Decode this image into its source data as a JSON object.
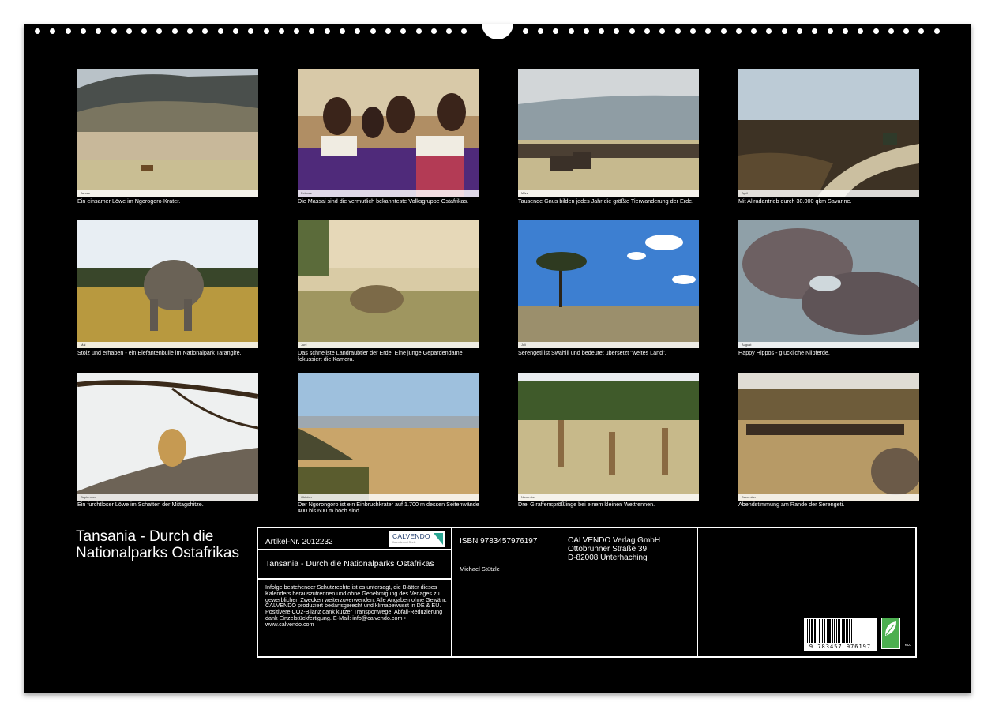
{
  "photos": [
    {
      "caption": "Ein einsamer Löwe im Ngorogoro-Krater.",
      "month": "Januar"
    },
    {
      "caption": "Die Massai sind die vermutlich bekannteste Volksgruppe Ostafrikas.",
      "month": "Februar"
    },
    {
      "caption": "Tausende Gnus bilden jedes Jahr die größte Tierwanderung der Erde.",
      "month": "März"
    },
    {
      "caption": "Mit Allradantrieb durch 30.000 qkm Savanne.",
      "month": "April"
    },
    {
      "caption": "Stolz und erhaben - ein Elefantenbulle im Nationalpark Tarangire.",
      "month": "Mai"
    },
    {
      "caption": "Das schnellste Landraubtier der Erde. Eine junge Gepardendame fokussiert die Kamera.",
      "month": "Juni"
    },
    {
      "caption": "Serengeti ist Swahili und bedeutet übersetzt \"weites Land\".",
      "month": "Juli"
    },
    {
      "caption": "Happy Hippos - glückliche Nilpferde.",
      "month": "August"
    },
    {
      "caption": "Ein furchtloser Löwe im Schatten der Mittagshitze.",
      "month": "September"
    },
    {
      "caption": "Der Ngorongoro ist ein Einbruchkrater auf 1.700 m dessen Seitenwände 400 bis 600 m hoch sind.",
      "month": "Oktober"
    },
    {
      "caption": "Drei Giraffensprößlinge bei einem kleinen Wettrennen.",
      "month": "November"
    },
    {
      "caption": "Abendstimmung am Rande der Serengeti.",
      "month": "Dezember"
    }
  ],
  "calendar_title": "Tansania - Durch die Nationalparks Ostafrikas",
  "info": {
    "article_no": "Artikel-Nr. 2012232",
    "calvendo_logo": "CALVENDO",
    "calvendo_logo_sub": "Kalender mit Seele",
    "title": "Tansania - Durch die Nationalparks Ostafrikas",
    "legal": "Infolge bestehender Schutzrechte ist es untersagt, die Blätter dieses Kalenders herauszutrennen und ohne Genehmigung des Verlages zu gewerblichen Zwecken weiterzuverwenden. Alle Angaben ohne Gewähr. CALVENDO produziert bedarfsgerecht und klimabewusst in DE & EU. Positivere CO2-Bilanz dank kurzer Transportwege. Abfall-Reduzierung dank Einzelstückfertigung. E-Mail: info@calvendo.com • www.calvendo.com",
    "isbn": "ISBN 9783457976197",
    "author": "Michael Stützle",
    "publisher": "CALVENDO Verlag GmbH",
    "street": "Ottobrunner Straße 39",
    "city": "D-82008 Unterhaching",
    "barcode_digits": "9 783457 976197",
    "eco_label": "eco"
  }
}
